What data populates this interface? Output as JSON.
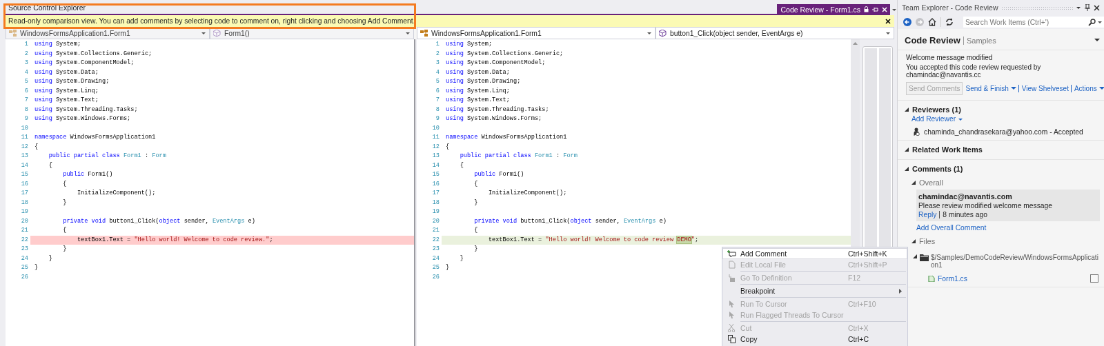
{
  "document_tabs": {
    "left_title": "Source Control Explorer",
    "tab": {
      "label": "Code Review - Form1.cs",
      "selected": true
    }
  },
  "info_bar": {
    "message": "Read-only comparison view. You can add comments by selecting code to comment on, right clicking and choosing Add Comment."
  },
  "panes": [
    {
      "kind": "original",
      "navigation": [
        {
          "label": "WindowsFormsApplication1.Form1",
          "kind": "class",
          "disabled": true
        },
        {
          "label": "Form1()",
          "kind": "method",
          "disabled": true
        }
      ],
      "lines": [
        {
          "number": "1",
          "changed": false,
          "segments": [
            {
              "kind": "kw",
              "text": "using"
            },
            {
              "kind": "plain",
              "text": " System;"
            }
          ]
        },
        {
          "number": "2",
          "changed": false,
          "segments": [
            {
              "kind": "kw",
              "text": "using"
            },
            {
              "kind": "plain",
              "text": " System.Collections.Generic;"
            }
          ]
        },
        {
          "number": "3",
          "changed": false,
          "segments": [
            {
              "kind": "kw",
              "text": "using"
            },
            {
              "kind": "plain",
              "text": " System.ComponentModel;"
            }
          ]
        },
        {
          "number": "4",
          "changed": false,
          "segments": [
            {
              "kind": "kw",
              "text": "using"
            },
            {
              "kind": "plain",
              "text": " System.Data;"
            }
          ]
        },
        {
          "number": "5",
          "changed": false,
          "segments": [
            {
              "kind": "kw",
              "text": "using"
            },
            {
              "kind": "plain",
              "text": " System.Drawing;"
            }
          ]
        },
        {
          "number": "6",
          "changed": false,
          "segments": [
            {
              "kind": "kw",
              "text": "using"
            },
            {
              "kind": "plain",
              "text": " System.Linq;"
            }
          ]
        },
        {
          "number": "7",
          "changed": false,
          "segments": [
            {
              "kind": "kw",
              "text": "using"
            },
            {
              "kind": "plain",
              "text": " System.Text;"
            }
          ]
        },
        {
          "number": "8",
          "changed": false,
          "segments": [
            {
              "kind": "kw",
              "text": "using"
            },
            {
              "kind": "plain",
              "text": " System.Threading.Tasks;"
            }
          ]
        },
        {
          "number": "9",
          "changed": false,
          "segments": [
            {
              "kind": "kw",
              "text": "using"
            },
            {
              "kind": "plain",
              "text": " System.Windows.Forms;"
            }
          ]
        },
        {
          "number": "10",
          "changed": false
        },
        {
          "number": "11",
          "changed": false,
          "segments": [
            {
              "kind": "kw",
              "text": "namespace"
            },
            {
              "kind": "plain",
              "text": " WindowsFormsApplication1"
            }
          ]
        },
        {
          "number": "12",
          "changed": false,
          "segments": [
            {
              "kind": "plain",
              "text": "{"
            }
          ]
        },
        {
          "number": "13",
          "changed": false,
          "segments": [
            {
              "kind": "kw",
              "text": "    public partial class"
            },
            {
              "kind": "type",
              "text": " Form1"
            },
            {
              "kind": "plain",
              "text": " : "
            },
            {
              "kind": "type",
              "text": "Form"
            }
          ]
        },
        {
          "number": "14",
          "changed": false,
          "segments": [
            {
              "kind": "plain",
              "text": "    {"
            }
          ]
        },
        {
          "number": "15",
          "changed": false,
          "segments": [
            {
              "kind": "kw",
              "text": "        public"
            },
            {
              "kind": "plain",
              "text": " Form1()"
            }
          ]
        },
        {
          "number": "16",
          "changed": false,
          "segments": [
            {
              "kind": "plain",
              "text": "        {"
            }
          ]
        },
        {
          "number": "17",
          "changed": false,
          "segments": [
            {
              "kind": "plain",
              "text": "            InitializeComponent();"
            }
          ]
        },
        {
          "number": "18",
          "changed": false,
          "segments": [
            {
              "kind": "plain",
              "text": "        }"
            }
          ]
        },
        {
          "number": "19",
          "changed": false
        },
        {
          "number": "20",
          "changed": false,
          "segments": [
            {
              "kind": "kw",
              "text": "        private void"
            },
            {
              "kind": "plain",
              "text": " button1_Click("
            },
            {
              "kind": "kw",
              "text": "object"
            },
            {
              "kind": "plain",
              "text": " sender, "
            },
            {
              "kind": "type",
              "text": "EventArgs"
            },
            {
              "kind": "plain",
              "text": " e)"
            }
          ]
        },
        {
          "number": "21",
          "changed": false,
          "segments": [
            {
              "kind": "plain",
              "text": "        {"
            }
          ]
        },
        {
          "number": "22",
          "changed": true,
          "segments": [
            {
              "kind": "plain",
              "text": "            textBox1.Text = "
            },
            {
              "kind": "str",
              "text": "\"Hello world! Welcome to code review.\""
            },
            {
              "kind": "plain",
              "text": ";"
            }
          ]
        },
        {
          "number": "23",
          "changed": false,
          "segments": [
            {
              "kind": "plain",
              "text": "        }"
            }
          ]
        },
        {
          "number": "24",
          "changed": false,
          "segments": [
            {
              "kind": "plain",
              "text": "    }"
            }
          ]
        },
        {
          "number": "25",
          "changed": false,
          "segments": [
            {
              "kind": "plain",
              "text": "}"
            }
          ]
        },
        {
          "number": "26",
          "changed": false
        }
      ]
    },
    {
      "kind": "modified",
      "navigation": [
        {
          "label": "WindowsFormsApplication1.Form1",
          "kind": "class",
          "disabled": false
        },
        {
          "label": "button1_Click(object sender, EventArgs e)",
          "kind": "method",
          "disabled": false
        }
      ],
      "lines": [
        {
          "number": "1",
          "changed": false,
          "segments": [
            {
              "kind": "kw",
              "text": "using"
            },
            {
              "kind": "plain",
              "text": " System;"
            }
          ]
        },
        {
          "number": "2",
          "changed": false,
          "segments": [
            {
              "kind": "kw",
              "text": "using"
            },
            {
              "kind": "plain",
              "text": " System.Collections.Generic;"
            }
          ]
        },
        {
          "number": "3",
          "changed": false,
          "segments": [
            {
              "kind": "kw",
              "text": "using"
            },
            {
              "kind": "plain",
              "text": " System.ComponentModel;"
            }
          ]
        },
        {
          "number": "4",
          "changed": false,
          "segments": [
            {
              "kind": "kw",
              "text": "using"
            },
            {
              "kind": "plain",
              "text": " System.Data;"
            }
          ]
        },
        {
          "number": "5",
          "changed": false,
          "segments": [
            {
              "kind": "kw",
              "text": "using"
            },
            {
              "kind": "plain",
              "text": " System.Drawing;"
            }
          ]
        },
        {
          "number": "6",
          "changed": false,
          "segments": [
            {
              "kind": "kw",
              "text": "using"
            },
            {
              "kind": "plain",
              "text": " System.Linq;"
            }
          ]
        },
        {
          "number": "7",
          "changed": false,
          "segments": [
            {
              "kind": "kw",
              "text": "using"
            },
            {
              "kind": "plain",
              "text": " System.Text;"
            }
          ]
        },
        {
          "number": "8",
          "changed": false,
          "segments": [
            {
              "kind": "kw",
              "text": "using"
            },
            {
              "kind": "plain",
              "text": " System.Threading.Tasks;"
            }
          ]
        },
        {
          "number": "9",
          "changed": false,
          "segments": [
            {
              "kind": "kw",
              "text": "using"
            },
            {
              "kind": "plain",
              "text": " System.Windows.Forms;"
            }
          ]
        },
        {
          "number": "10",
          "changed": false
        },
        {
          "number": "11",
          "changed": false,
          "segments": [
            {
              "kind": "kw",
              "text": "namespace"
            },
            {
              "kind": "plain",
              "text": " WindowsFormsApplication1"
            }
          ]
        },
        {
          "number": "12",
          "changed": false,
          "segments": [
            {
              "kind": "plain",
              "text": "{"
            }
          ]
        },
        {
          "number": "13",
          "changed": false,
          "segments": [
            {
              "kind": "kw",
              "text": "    public partial class"
            },
            {
              "kind": "type",
              "text": " Form1"
            },
            {
              "kind": "plain",
              "text": " : "
            },
            {
              "kind": "type",
              "text": "Form"
            }
          ]
        },
        {
          "number": "14",
          "changed": false,
          "segments": [
            {
              "kind": "plain",
              "text": "    {"
            }
          ]
        },
        {
          "number": "15",
          "changed": false,
          "segments": [
            {
              "kind": "kw",
              "text": "        public"
            },
            {
              "kind": "plain",
              "text": " Form1()"
            }
          ]
        },
        {
          "number": "16",
          "changed": false,
          "segments": [
            {
              "kind": "plain",
              "text": "        {"
            }
          ]
        },
        {
          "number": "17",
          "changed": false,
          "segments": [
            {
              "kind": "plain",
              "text": "            InitializeComponent();"
            }
          ]
        },
        {
          "number": "18",
          "changed": false,
          "segments": [
            {
              "kind": "plain",
              "text": "        }"
            }
          ]
        },
        {
          "number": "19",
          "changed": false
        },
        {
          "number": "20",
          "changed": false,
          "segments": [
            {
              "kind": "kw",
              "text": "        private void"
            },
            {
              "kind": "plain",
              "text": " button1_Click("
            },
            {
              "kind": "kw",
              "text": "object"
            },
            {
              "kind": "plain",
              "text": " sender, "
            },
            {
              "kind": "type",
              "text": "EventArgs"
            },
            {
              "kind": "plain",
              "text": " e)"
            }
          ]
        },
        {
          "number": "21",
          "changed": false,
          "segments": [
            {
              "kind": "plain",
              "text": "        {"
            }
          ]
        },
        {
          "number": "22",
          "changed": true,
          "segments": [
            {
              "kind": "plain",
              "text": "            textBox1.Text = "
            },
            {
              "kind": "str",
              "text": "\"Hello world! Welcome to code review "
            },
            {
              "kind": "selected_str",
              "text": "DEMO"
            },
            {
              "kind": "str",
              "text": "\""
            },
            {
              "kind": "plain",
              "text": ";"
            }
          ]
        },
        {
          "number": "23",
          "changed": false,
          "segments": [
            {
              "kind": "plain",
              "text": "        }"
            }
          ]
        },
        {
          "number": "24",
          "changed": false,
          "segments": [
            {
              "kind": "plain",
              "text": "    }"
            }
          ]
        },
        {
          "number": "25",
          "changed": false,
          "segments": [
            {
              "kind": "plain",
              "text": "}"
            }
          ]
        },
        {
          "number": "26",
          "changed": false
        }
      ]
    }
  ],
  "context_menu": {
    "groups": [
      {
        "items": [
          {
            "label": "Add Comment",
            "shortcut": "Ctrl+Shift+K",
            "kind": "command",
            "disabled": false,
            "highlighted": true
          },
          {
            "label": "Edit Local File",
            "shortcut": "Ctrl+Shift+P",
            "kind": "command",
            "disabled": true,
            "highlighted": false
          }
        ]
      },
      {
        "items": [
          {
            "label": "Go To Definition",
            "shortcut": "F12",
            "kind": "command",
            "disabled": true,
            "highlighted": false
          }
        ]
      },
      {
        "items": [
          {
            "label": "Breakpoint",
            "kind": "submenu",
            "disabled": false,
            "highlighted": false
          }
        ]
      },
      {
        "items": [
          {
            "label": "Run To Cursor",
            "shortcut": "Ctrl+F10",
            "kind": "command",
            "disabled": true,
            "highlighted": false
          },
          {
            "label": "Run Flagged Threads To Cursor",
            "kind": "command",
            "disabled": true,
            "highlighted": false
          }
        ]
      },
      {
        "items": [
          {
            "label": "Cut",
            "shortcut": "Ctrl+X",
            "kind": "command",
            "disabled": true,
            "highlighted": false
          },
          {
            "label": "Copy",
            "shortcut": "Ctrl+C",
            "kind": "command",
            "disabled": false,
            "highlighted": false
          }
        ]
      }
    ]
  },
  "team_explorer": {
    "title": "Team Explorer - Code Review",
    "search": {
      "placeholder": "Search Work Items (Ctrl+')"
    },
    "page": {
      "title": "Code Review",
      "context": "Samples"
    },
    "summary": [
      "Welcome message modified",
      "You accepted this code review requested by chamindac@navantis.cc"
    ],
    "actions": [
      {
        "label": "Send Comments",
        "kind": "button",
        "disabled": true,
        "dropdown": false
      },
      {
        "label": "Send & Finish",
        "kind": "link",
        "disabled": false,
        "dropdown": true
      },
      {
        "label": "View Shelveset",
        "kind": "link",
        "disabled": false,
        "dropdown": false
      },
      {
        "label": "Actions",
        "kind": "link",
        "disabled": false,
        "dropdown": true
      }
    ],
    "sections": [
      {
        "title": "Reviewers (1)",
        "kind": "reviewers",
        "expanded": true,
        "link": "Add Reviewer",
        "reviewers": [
          "chaminda_chandrasekara@yahoo.com - Accepted"
        ]
      },
      {
        "title": "Related Work Items",
        "kind": "work_items",
        "expanded": true
      },
      {
        "title": "Comments (1)",
        "kind": "comments",
        "expanded": true,
        "groups": [
          {
            "title": "Overall",
            "kind": "overall",
            "expanded": true,
            "comments": [
              {
                "author": "chamindac@navantis.com",
                "body": "Please review modified welcome message",
                "reply": "Reply",
                "time": "8 minutes ago"
              }
            ],
            "add_link": "Add Overall Comment"
          },
          {
            "title": "Files",
            "kind": "files",
            "expanded": true,
            "folders": [
              {
                "path": "$/Samples/DemoCodeReview/WindowsFormsApplication1",
                "expanded": true,
                "files": [
                  {
                    "name": "Form1.cs",
                    "checked": false
                  }
                ]
              }
            ]
          }
        ]
      }
    ]
  }
}
